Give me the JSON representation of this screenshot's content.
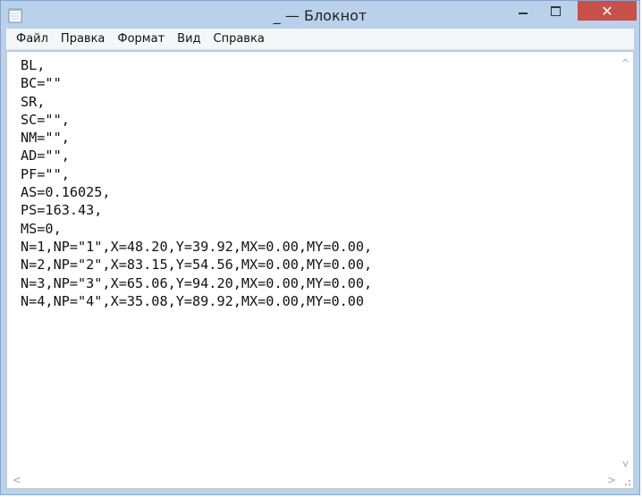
{
  "window": {
    "title": "_ — Блокнот",
    "controls": {
      "minimize_icon": "minimize-icon",
      "maximize_icon": "maximize-icon",
      "close_label": "✕"
    }
  },
  "menu": {
    "items": [
      {
        "label": "Файл"
      },
      {
        "label": "Правка"
      },
      {
        "label": "Формат"
      },
      {
        "label": "Вид"
      },
      {
        "label": "Справка"
      }
    ]
  },
  "editor": {
    "lines": [
      "BL,",
      "BC=\"\"",
      "SR,",
      "SC=\"\",",
      "NM=\"\",",
      "AD=\"\",",
      "PF=\"\",",
      "AS=0.16025,",
      "PS=163.43,",
      "MS=0,",
      "N=1,NP=\"1\",X=48.20,Y=39.92,MX=0.00,MY=0.00,",
      "N=2,NP=\"2\",X=83.15,Y=54.56,MX=0.00,MY=0.00,",
      "N=3,NP=\"3\",X=65.06,Y=94.20,MX=0.00,MY=0.00,",
      "N=4,NP=\"4\",X=35.08,Y=89.92,MX=0.00,MY=0.00"
    ]
  },
  "scrollbars": {
    "up_arrow": "^",
    "down_arrow": "v",
    "left_arrow": "<",
    "right_arrow": ">"
  },
  "colors": {
    "titlebar": "#b9d1ea",
    "close_button": "#c7504b"
  }
}
